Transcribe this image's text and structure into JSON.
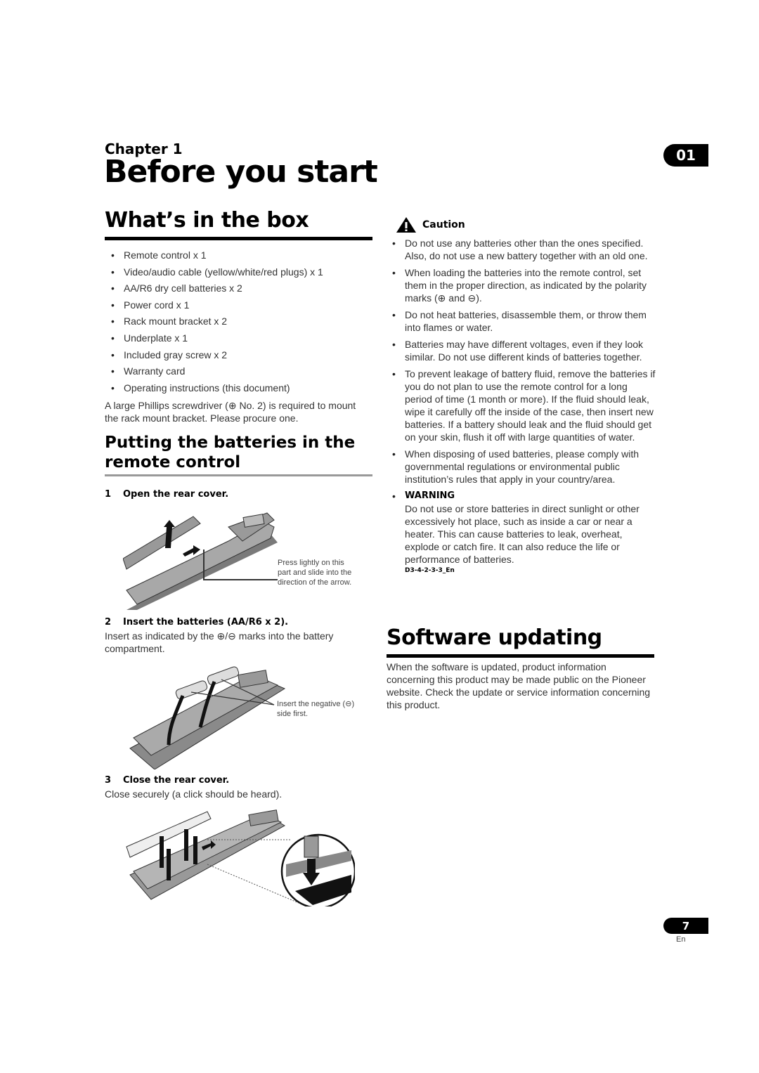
{
  "header": {
    "chapter_label": "Chapter 1",
    "page_title": "Before you start",
    "chapter_tab": "01"
  },
  "whats_in_box": {
    "heading": "What’s in the box",
    "items": [
      "Remote control x 1",
      "Video/audio cable (yellow/white/red plugs) x 1",
      "AA/R6 dry cell batteries x 2",
      "Power cord x 1",
      "Rack mount bracket x 2",
      "Underplate x 1",
      "Included gray screw x 2",
      "Warranty card",
      "Operating instructions (this document)"
    ],
    "note": "A large Phillips screwdriver (⊕ No. 2) is required to mount the rack mount bracket. Please procure one."
  },
  "batteries": {
    "heading": "Putting the batteries in the remote control",
    "steps": [
      {
        "num": "1",
        "title": "Open the rear cover.",
        "text": "",
        "caption": "Press lightly on this part and slide into the direction of the arrow."
      },
      {
        "num": "2",
        "title": "Insert the batteries (AA/R6 x 2).",
        "text": "Insert as indicated by the ⊕/⊖ marks into the battery compartment.",
        "caption": "Insert the negative (⊖) side first."
      },
      {
        "num": "3",
        "title": "Close the rear cover.",
        "text": "Close securely (a click should be heard).",
        "caption": ""
      }
    ]
  },
  "caution": {
    "heading": "Caution",
    "items": [
      "Do not use any batteries other than the ones specified. Also, do not use a new battery together with an old one.",
      "When loading the batteries into the remote control, set them in the proper direction, as indicated by the polarity marks (⊕ and ⊖).",
      "Do not heat batteries, disassemble them, or throw them into flames or water.",
      "Batteries may have different voltages, even if they look similar. Do not use different kinds of batteries together.",
      "To prevent leakage of battery fluid, remove the batteries if you do not plan to use the remote control for a long period of time (1 month or more). If the fluid should leak, wipe it carefully off the inside of the case, then insert new batteries. If a battery should leak and the fluid should get on your skin, flush it off with large quantities of water.",
      "When disposing of used batteries, please comply with governmental regulations or environmental public institution’s rules that apply in your country/area."
    ],
    "warning_label": "WARNING",
    "warning_text": "Do not use or store batteries in direct sunlight or other excessively hot place, such as inside a car or near a heater. This can cause batteries to leak, overheat, explode or catch fire. It can also reduce the life or performance of batteries.",
    "code": "D3-4-2-3-3_En"
  },
  "software": {
    "heading": "Software updating",
    "text": "When the software is updated, product information concerning this product may be made public on the Pioneer website. Check the update or service information concerning this product."
  },
  "footer": {
    "page_number": "7",
    "language": "En"
  }
}
